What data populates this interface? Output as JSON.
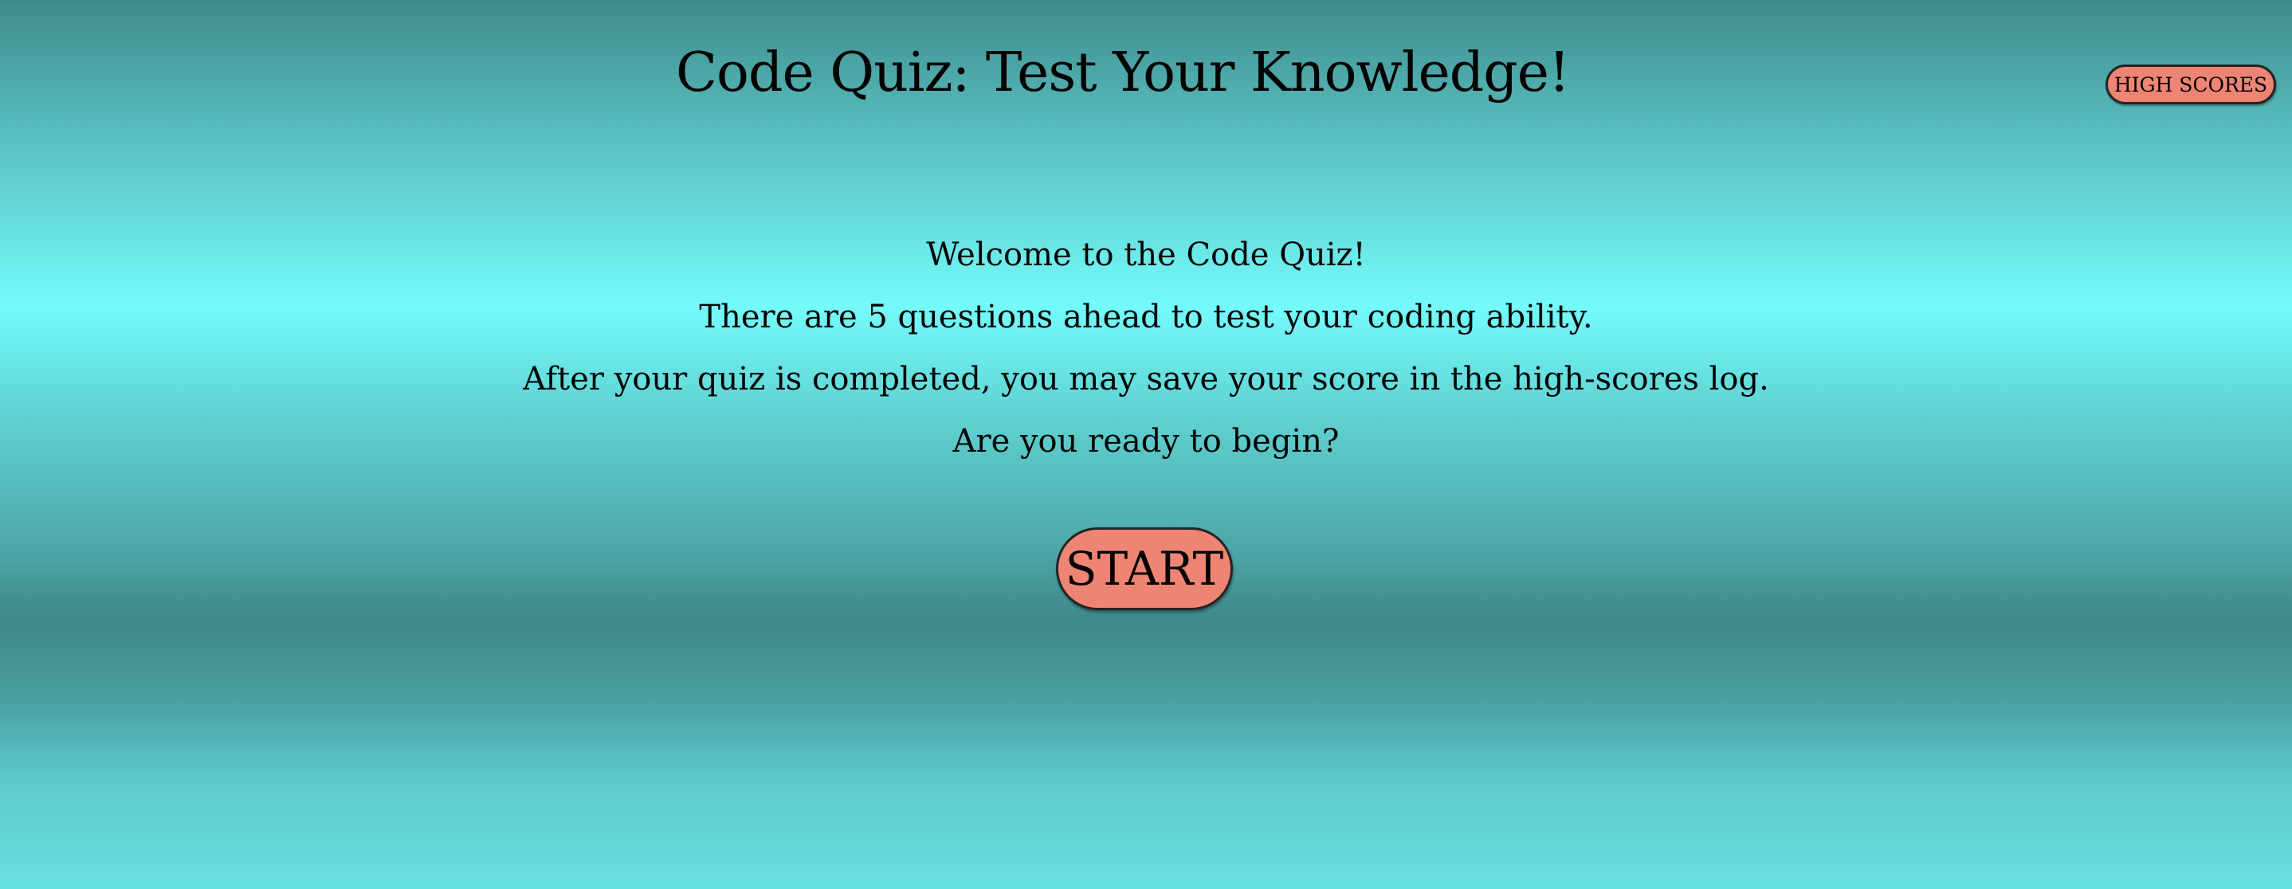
{
  "header": {
    "title": "Code Quiz: Test Your Knowledge!",
    "high_scores_label": "HIGH SCORES"
  },
  "intro": {
    "lines": [
      "Welcome to the Code Quiz!",
      "There are 5 questions ahead to test your coding ability.",
      "After your quiz is completed, you may save your score in the high-scores log.",
      "Are you ready to begin?"
    ]
  },
  "start": {
    "label": "START"
  },
  "colors": {
    "button": "#ee8574",
    "background_light": "#74fbfb",
    "background_dark": "#3e8989"
  }
}
